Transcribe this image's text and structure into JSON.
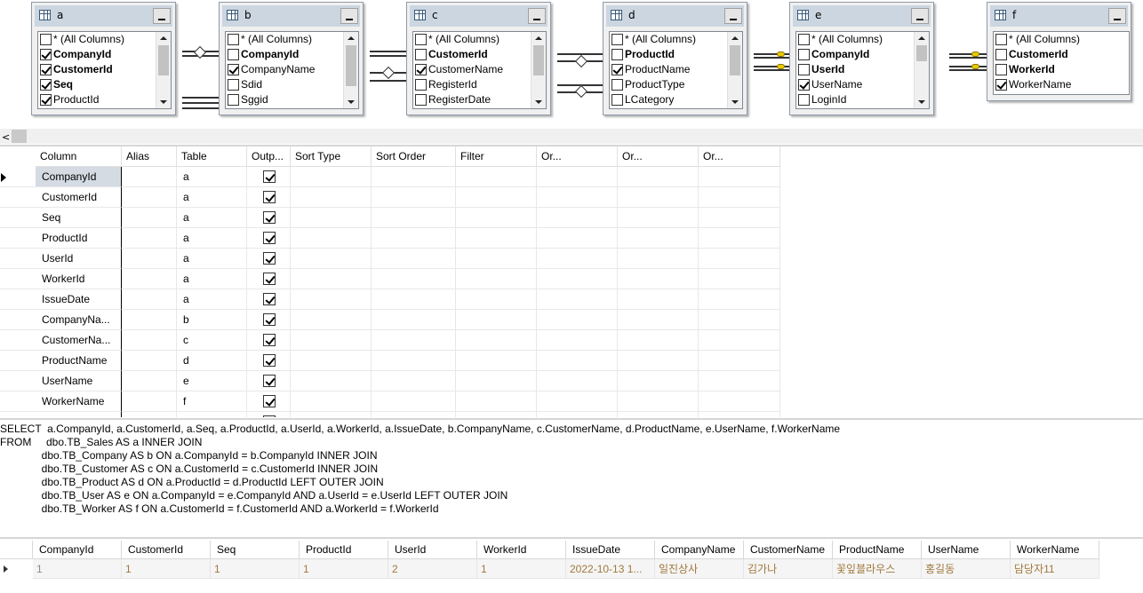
{
  "tables": [
    {
      "name": "a",
      "columns": [
        {
          "label": "* (All Columns)",
          "checked": false,
          "bold": false
        },
        {
          "label": "CompanyId",
          "checked": true,
          "bold": true
        },
        {
          "label": "CustomerId",
          "checked": true,
          "bold": true
        },
        {
          "label": "Seq",
          "checked": true,
          "bold": true
        },
        {
          "label": "ProductId",
          "checked": true,
          "bold": false
        }
      ]
    },
    {
      "name": "b",
      "columns": [
        {
          "label": "* (All Columns)",
          "checked": false,
          "bold": false
        },
        {
          "label": "CompanyId",
          "checked": false,
          "bold": true
        },
        {
          "label": "CompanyName",
          "checked": true,
          "bold": false
        },
        {
          "label": "Sdid",
          "checked": false,
          "bold": false
        },
        {
          "label": "Sggid",
          "checked": false,
          "bold": false
        }
      ]
    },
    {
      "name": "c",
      "columns": [
        {
          "label": "* (All Columns)",
          "checked": false,
          "bold": false
        },
        {
          "label": "CustomerId",
          "checked": false,
          "bold": true
        },
        {
          "label": "CustomerName",
          "checked": true,
          "bold": false
        },
        {
          "label": "RegisterId",
          "checked": false,
          "bold": false
        },
        {
          "label": "RegisterDate",
          "checked": false,
          "bold": false
        }
      ]
    },
    {
      "name": "d",
      "columns": [
        {
          "label": "* (All Columns)",
          "checked": false,
          "bold": false
        },
        {
          "label": "ProductId",
          "checked": false,
          "bold": true
        },
        {
          "label": "ProductName",
          "checked": true,
          "bold": false
        },
        {
          "label": "ProductType",
          "checked": false,
          "bold": false
        },
        {
          "label": "LCategory",
          "checked": false,
          "bold": false
        }
      ]
    },
    {
      "name": "e",
      "columns": [
        {
          "label": "* (All Columns)",
          "checked": false,
          "bold": false
        },
        {
          "label": "CompanyId",
          "checked": false,
          "bold": true
        },
        {
          "label": "UserId",
          "checked": false,
          "bold": true
        },
        {
          "label": "UserName",
          "checked": true,
          "bold": false
        },
        {
          "label": "LoginId",
          "checked": false,
          "bold": false
        }
      ]
    },
    {
      "name": "f",
      "columns": [
        {
          "label": "* (All Columns)",
          "checked": false,
          "bold": false
        },
        {
          "label": "CustomerId",
          "checked": false,
          "bold": true
        },
        {
          "label": "WorkerId",
          "checked": false,
          "bold": true
        },
        {
          "label": "WorkerName",
          "checked": true,
          "bold": false
        }
      ]
    }
  ],
  "grid": {
    "headers": [
      "Column",
      "Alias",
      "Table",
      "Outp...",
      "Sort Type",
      "Sort Order",
      "Filter",
      "Or...",
      "Or...",
      "Or..."
    ],
    "rows": [
      {
        "column": "CompanyId",
        "alias": "",
        "table": "a",
        "output": true
      },
      {
        "column": "CustomerId",
        "alias": "",
        "table": "a",
        "output": true
      },
      {
        "column": "Seq",
        "alias": "",
        "table": "a",
        "output": true
      },
      {
        "column": "ProductId",
        "alias": "",
        "table": "a",
        "output": true
      },
      {
        "column": "UserId",
        "alias": "",
        "table": "a",
        "output": true
      },
      {
        "column": "WorkerId",
        "alias": "",
        "table": "a",
        "output": true
      },
      {
        "column": "IssueDate",
        "alias": "",
        "table": "a",
        "output": true
      },
      {
        "column": "CompanyNa...",
        "alias": "",
        "table": "b",
        "output": true
      },
      {
        "column": "CustomerNa...",
        "alias": "",
        "table": "c",
        "output": true
      },
      {
        "column": "ProductName",
        "alias": "",
        "table": "d",
        "output": true
      },
      {
        "column": "UserName",
        "alias": "",
        "table": "e",
        "output": true
      },
      {
        "column": "WorkerName",
        "alias": "",
        "table": "f",
        "output": true
      },
      {
        "column": "",
        "alias": "",
        "table": "",
        "output": true
      }
    ]
  },
  "sql": [
    "SELECT  a.CompanyId, a.CustomerId, a.Seq, a.ProductId, a.UserId, a.WorkerId, a.IssueDate, b.CompanyName, c.CustomerName, d.ProductName, e.UserName, f.WorkerName",
    "FROM     dbo.TB_Sales AS a INNER JOIN",
    "              dbo.TB_Company AS b ON a.CompanyId = b.CompanyId INNER JOIN",
    "              dbo.TB_Customer AS c ON a.CustomerId = c.CustomerId INNER JOIN",
    "              dbo.TB_Product AS d ON a.ProductId = d.ProductId LEFT OUTER JOIN",
    "              dbo.TB_User AS e ON a.CompanyId = e.CompanyId AND a.UserId = e.UserId LEFT OUTER JOIN",
    "              dbo.TB_Worker AS f ON a.CustomerId = f.CustomerId AND a.WorkerId = f.WorkerId"
  ],
  "results": {
    "headers": [
      "CompanyId",
      "CustomerId",
      "Seq",
      "ProductId",
      "UserId",
      "WorkerId",
      "IssueDate",
      "CompanyName",
      "CustomerName",
      "ProductName",
      "UserName",
      "WorkerName"
    ],
    "rows": [
      [
        "1",
        "1",
        "1",
        "1",
        "2",
        "1",
        "2022-10-13 1...",
        "일진상사",
        "김가나",
        "꽃잎블라우스",
        "홍길동",
        "담당자11"
      ]
    ]
  },
  "colors": {
    "selection": "#d4dbe3",
    "table_header": "#ccd6e1",
    "result_text": "#a0783c"
  }
}
